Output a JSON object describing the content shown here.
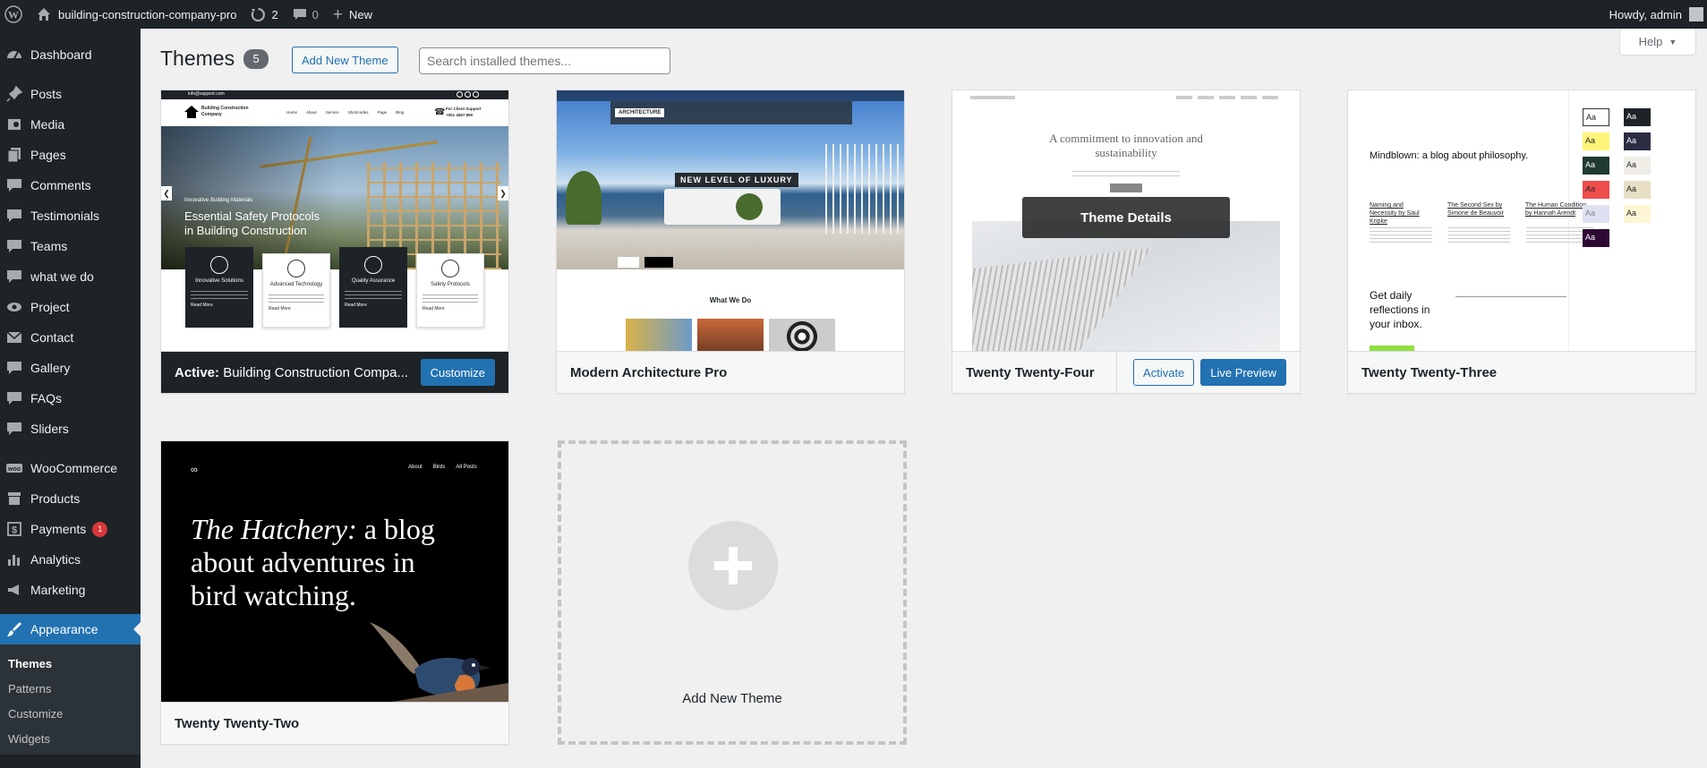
{
  "admin_bar": {
    "site_name": "building-construction-company-pro",
    "updates_count": "2",
    "comments_count": "0",
    "new_label": "New",
    "greeting": "Howdy, admin"
  },
  "sidebar": {
    "items": [
      {
        "label": "Dashboard",
        "icon": "dashboard-icon"
      },
      {
        "label": "Posts",
        "icon": "pin-icon"
      },
      {
        "label": "Media",
        "icon": "media-icon"
      },
      {
        "label": "Pages",
        "icon": "pages-icon"
      },
      {
        "label": "Comments",
        "icon": "comment-icon"
      },
      {
        "label": "Testimonials",
        "icon": "testimonial-icon"
      },
      {
        "label": "Teams",
        "icon": "teams-icon"
      },
      {
        "label": "what we do",
        "icon": "bubble-icon"
      },
      {
        "label": "Project",
        "icon": "project-icon"
      },
      {
        "label": "Contact",
        "icon": "mail-icon"
      },
      {
        "label": "Gallery",
        "icon": "gallery-icon"
      },
      {
        "label": "FAQs",
        "icon": "faq-icon"
      },
      {
        "label": "Sliders",
        "icon": "slider-icon"
      },
      {
        "label": "WooCommerce",
        "icon": "woo-icon"
      },
      {
        "label": "Products",
        "icon": "archive-icon"
      },
      {
        "label": "Payments",
        "icon": "dollar-icon",
        "badge": "1"
      },
      {
        "label": "Analytics",
        "icon": "chart-icon"
      },
      {
        "label": "Marketing",
        "icon": "megaphone-icon"
      },
      {
        "label": "Appearance",
        "icon": "brush-icon"
      }
    ],
    "submenu": [
      "Themes",
      "Patterns",
      "Customize",
      "Widgets"
    ]
  },
  "page": {
    "title": "Themes",
    "count": "5",
    "add_new_label": "Add New Theme",
    "search_placeholder": "Search installed themes...",
    "help_label": "Help"
  },
  "themes": [
    {
      "name": "Building Construction Compa...",
      "active_prefix": "Active:",
      "customize_label": "Customize",
      "screenshot": {
        "topbar_email": "info@support.com",
        "brand": "Building Construction Company",
        "nav": [
          "Home",
          "About",
          "Service",
          "Shortcodes",
          "Page",
          "Blog"
        ],
        "support": "For Client Support",
        "support_phone": "+001 4567 890",
        "kicker": "Innovative Building Materials",
        "headline_1": "Essential Safety Protocols",
        "headline_2": "in Building Construction",
        "features": [
          "Innovative Solutions",
          "Advanced Technology",
          "Quality Assurance",
          "Safety Protocols"
        ],
        "read_more": "Read More"
      }
    },
    {
      "name": "Modern Architecture Pro",
      "screenshot": {
        "banner": "NEW LEVEL OF LUXURY",
        "logo": "ARCHITECTURE",
        "section": "What We Do"
      }
    },
    {
      "name": "Twenty Twenty-Four",
      "details_label": "Theme Details",
      "activate_label": "Activate",
      "preview_label": "Live Preview",
      "screenshot": {
        "headline": "A commitment to innovation and sustainability"
      }
    },
    {
      "name": "Twenty Twenty-Three",
      "screenshot": {
        "headline": "Mindblown: a blog about philosophy.",
        "posts": [
          "Naming and Necessity by Saul Kripke",
          "The Second Sex by Simone de Beauvoir",
          "The Human Condition by Hannah Arendt"
        ],
        "cta": "Get daily reflections in your inbox.",
        "swatch_label": "Aa"
      }
    },
    {
      "name": "Twenty Twenty-Two",
      "screenshot": {
        "headline_italic": "The Hatchery:",
        "headline_rest": "a blog about adventures in bird watching.",
        "nav": [
          "About",
          "Birds",
          "All Posts"
        ]
      }
    }
  ],
  "add_new_tile": {
    "label": "Add New Theme"
  },
  "colors": {
    "accent": "#2271b1",
    "admin_dark": "#1d2327",
    "badge_red": "#d63638"
  }
}
